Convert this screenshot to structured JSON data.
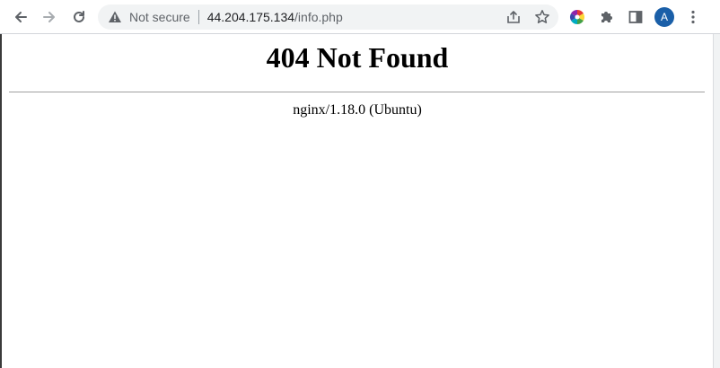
{
  "browser": {
    "security_label": "Not secure",
    "url_host": "44.204.175.134",
    "url_path": "/info.php",
    "avatar_letter": "A",
    "icons": [
      "back-arrow-icon",
      "forward-arrow-icon",
      "reload-icon",
      "warning-icon",
      "share-icon",
      "star-icon",
      "color-wheel-extension-icon",
      "puzzle-extensions-icon",
      "side-panel-icon",
      "kebab-menu-icon"
    ],
    "avatar_color": "#1a5fa8"
  },
  "page": {
    "heading": "404 Not Found",
    "server": "nginx/1.18.0 (Ubuntu)"
  }
}
